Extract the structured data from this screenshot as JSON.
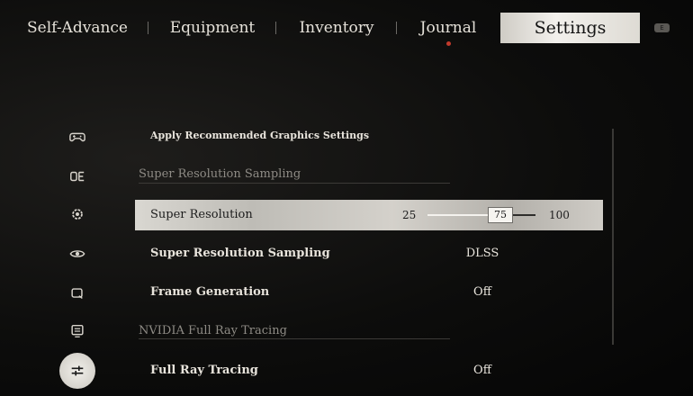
{
  "tabs": [
    {
      "label": "Self-Advance"
    },
    {
      "label": "Equipment"
    },
    {
      "label": "Inventory"
    },
    {
      "label": "Journal"
    },
    {
      "label": "Settings"
    }
  ],
  "active_tab": "Settings",
  "side_icons": [
    {
      "name": "controller-icon"
    },
    {
      "name": "display-icon"
    },
    {
      "name": "gear-icon"
    },
    {
      "name": "eye-icon"
    },
    {
      "name": "frame-icon"
    },
    {
      "name": "monitor-icon"
    },
    {
      "name": "sliders-icon",
      "active": true
    }
  ],
  "settings": {
    "apply_recommended": "Apply Recommended Graphics Settings",
    "section_sampling": "Super Resolution Sampling",
    "super_resolution": {
      "label": "Super Resolution",
      "min": "25",
      "max": "100",
      "value": "75",
      "value_num": 75,
      "min_num": 25,
      "max_num": 100
    },
    "super_resolution_sampling": {
      "label": "Super Resolution Sampling",
      "value": "DLSS"
    },
    "frame_generation": {
      "label": "Frame Generation",
      "value": "Off"
    },
    "section_ray_tracing": "NVIDIA Full Ray Tracing",
    "full_ray_tracing": {
      "label": "Full Ray Tracing",
      "value": "Off"
    }
  },
  "colors": {
    "notification_dot": "#c23a2c",
    "selected_row": "#cfccc6"
  }
}
